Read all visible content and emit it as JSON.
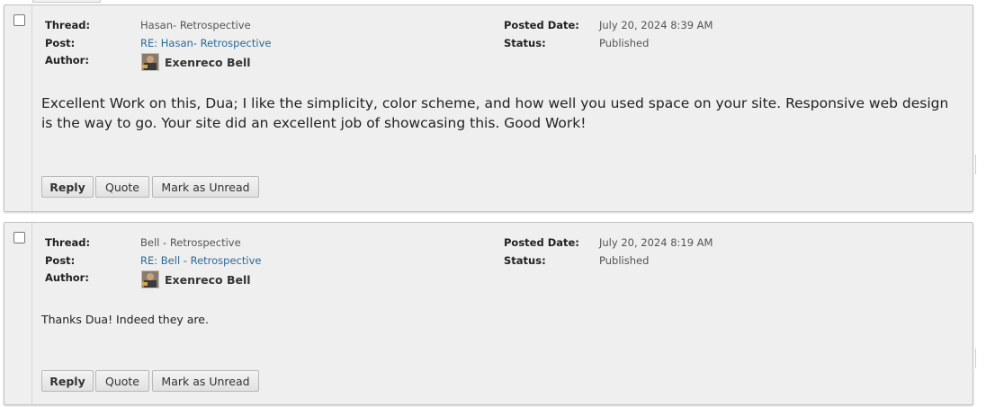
{
  "labels": {
    "thread": "Thread:",
    "post": "Post:",
    "author": "Author:",
    "posted_date": "Posted Date:",
    "status": "Status:"
  },
  "buttons": {
    "reply": "Reply",
    "quote": "Quote",
    "mark_unread": "Mark as Unread"
  },
  "posts": [
    {
      "thread": "Hasan- Retrospective",
      "post": "RE: Hasan- Retrospective",
      "author": "Exenreco Bell",
      "posted_date": "July 20, 2024 8:39 AM",
      "status": "Published",
      "body": "Excellent Work on this, Dua; I like the simplicity, color scheme, and how well you used space on your site. Responsive web design is the way to go. Your site did an excellent job of showcasing this. Good Work!"
    },
    {
      "thread": "Bell - Retrospective",
      "post": "RE: Bell - Retrospective",
      "author": "Exenreco Bell",
      "posted_date": "July 20, 2024 8:19 AM",
      "status": "Published",
      "body": "Thanks Dua! Indeed they are."
    }
  ]
}
